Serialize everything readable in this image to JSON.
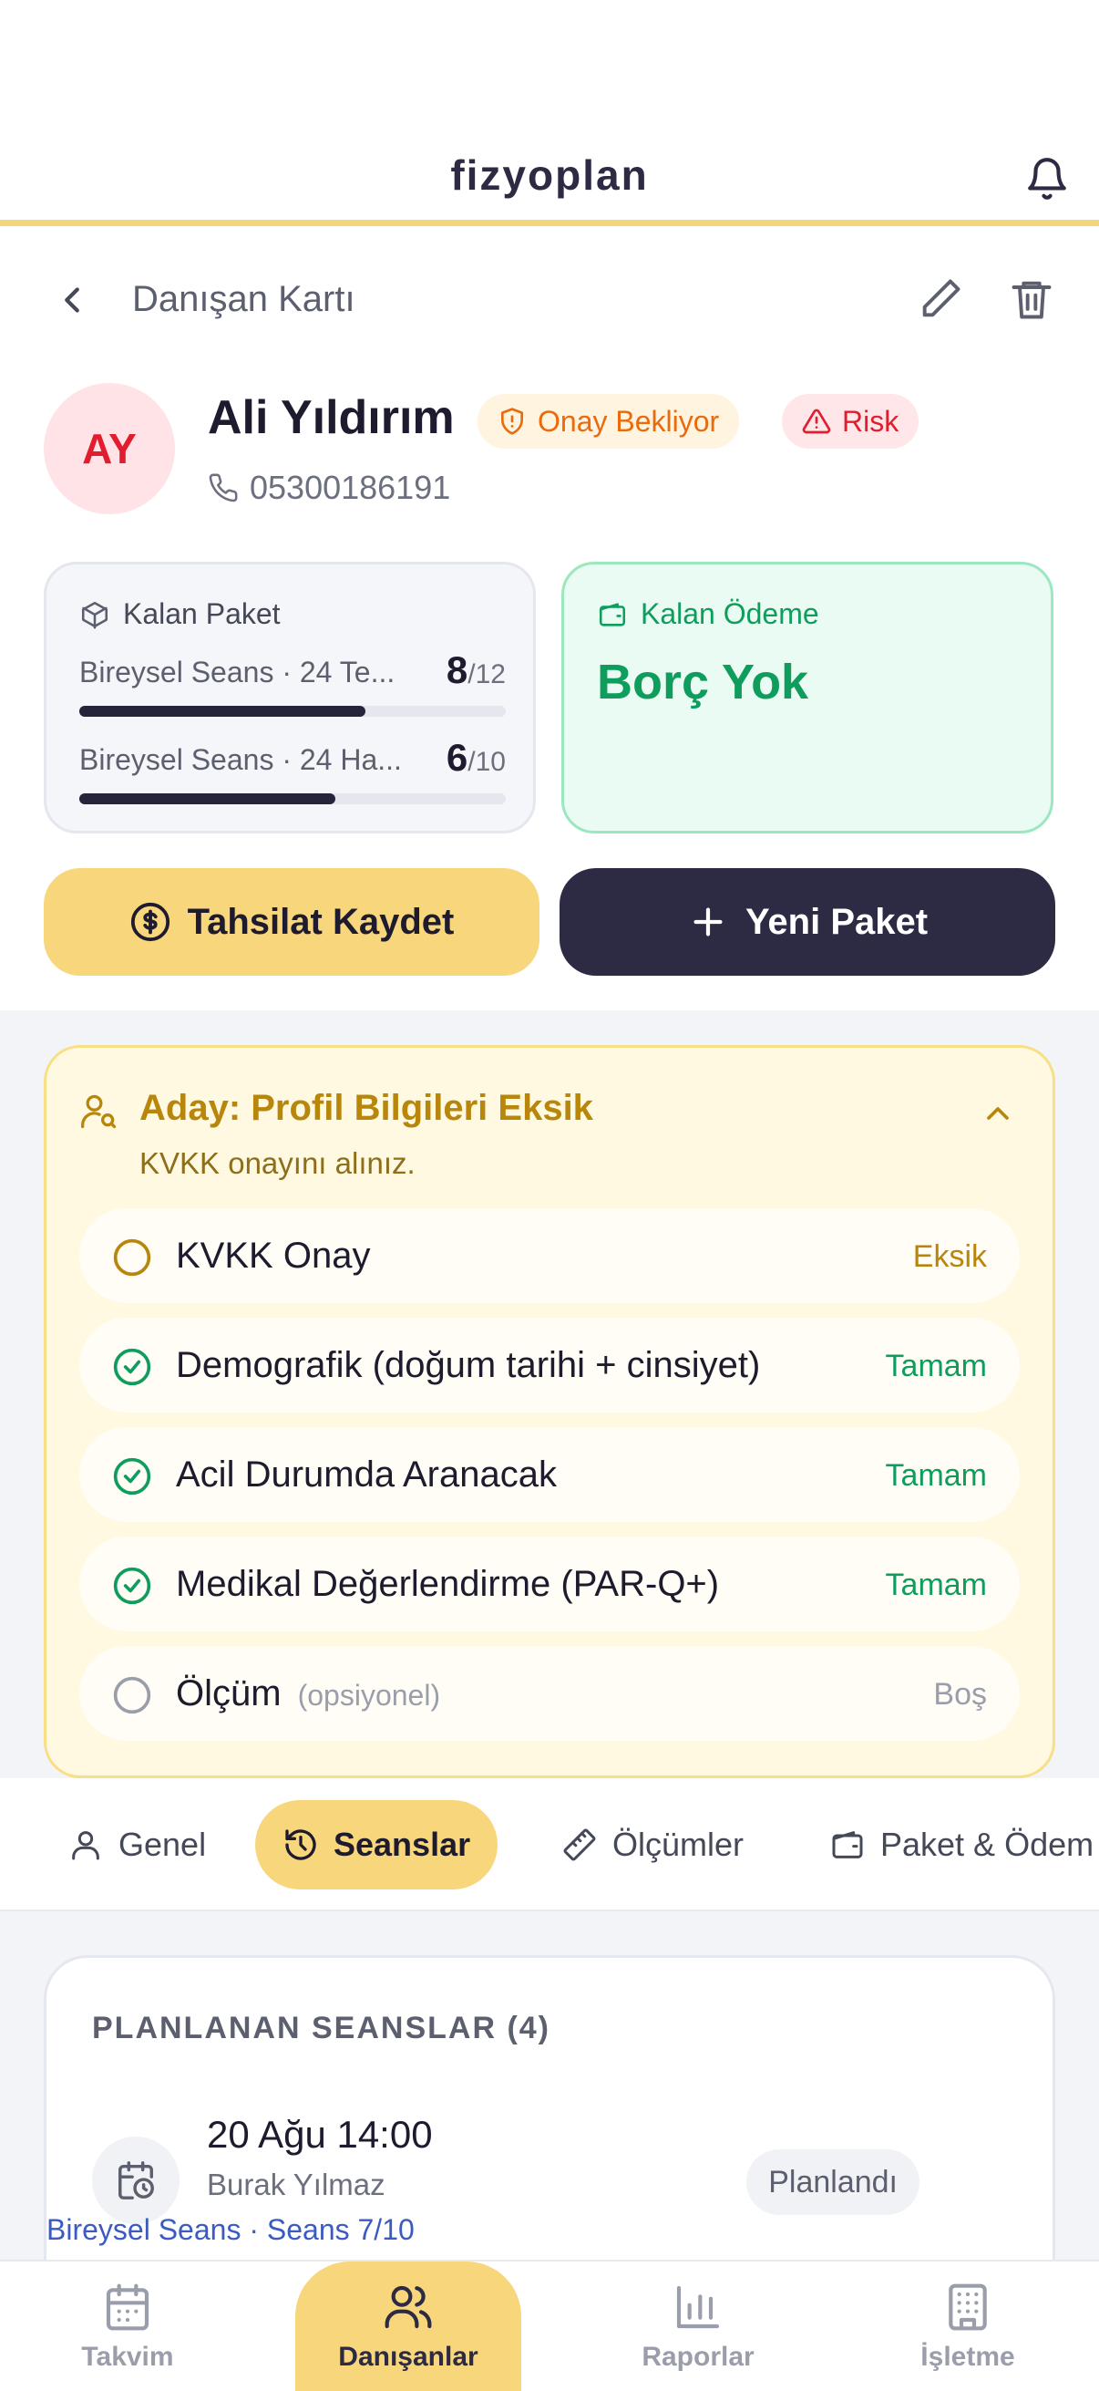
{
  "app": {
    "logo": "fizyoplan"
  },
  "titlebar": {
    "title": "Danışan Kartı"
  },
  "client": {
    "initials": "AY",
    "name": "Ali Yıldırım",
    "phone": "05300186191",
    "badges": {
      "pending": "Onay Bekliyor",
      "risk": "Risk"
    }
  },
  "package_card": {
    "title": "Kalan Paket",
    "rows": [
      {
        "label": "Bireysel Seans · 24 Te...",
        "remaining": "8",
        "total": "/12",
        "progress": 0.67
      },
      {
        "label": "Bireysel Seans · 24 Ha...",
        "remaining": "6",
        "total": "/10",
        "progress": 0.6
      }
    ]
  },
  "payment_card": {
    "title": "Kalan Ödeme",
    "value": "Borç Yok"
  },
  "actions": {
    "payment": "Tahsilat Kaydet",
    "new_package": "Yeni Paket"
  },
  "alert": {
    "title": "Aday: Profil Bilgileri Eksik",
    "subtitle": "KVKK onayını alınız.",
    "items": [
      {
        "label": "KVKK Onay",
        "optional": "",
        "status": "Eksik",
        "state": "missing"
      },
      {
        "label": "Demografik (doğum tarihi + cinsiyet)",
        "optional": "",
        "status": "Tamam",
        "state": "ok"
      },
      {
        "label": "Acil Durumda Aranacak",
        "optional": "",
        "status": "Tamam",
        "state": "ok"
      },
      {
        "label": "Medikal Değerlendirme (PAR-Q+)",
        "optional": "",
        "status": "Tamam",
        "state": "ok"
      },
      {
        "label": "Ölçüm",
        "optional": "(opsiyonel)",
        "status": "Boş",
        "state": "empty"
      }
    ]
  },
  "tabs": [
    {
      "label": "Genel"
    },
    {
      "label": "Seanslar"
    },
    {
      "label": "Ölçümler"
    },
    {
      "label": "Paket & Ödem"
    }
  ],
  "sessions": {
    "title": "PLANLANAN SEANSLAR (4)",
    "items": [
      {
        "date": "20 Ağu 14:00",
        "trainer": "Burak Yılmaz",
        "package": "Bireysel Seans · Seans 7/10",
        "status": "Planlandı"
      }
    ]
  },
  "bottom_nav": [
    {
      "label": "Takvim"
    },
    {
      "label": "Danışanlar"
    },
    {
      "label": "Raporlar"
    },
    {
      "label": "İşletme"
    }
  ],
  "colors": {
    "accent": "#f8d67c",
    "dark": "#2d2a44",
    "success": "#0f9d5e",
    "danger": "#e11d2e",
    "warning": "#ea6a0c"
  }
}
